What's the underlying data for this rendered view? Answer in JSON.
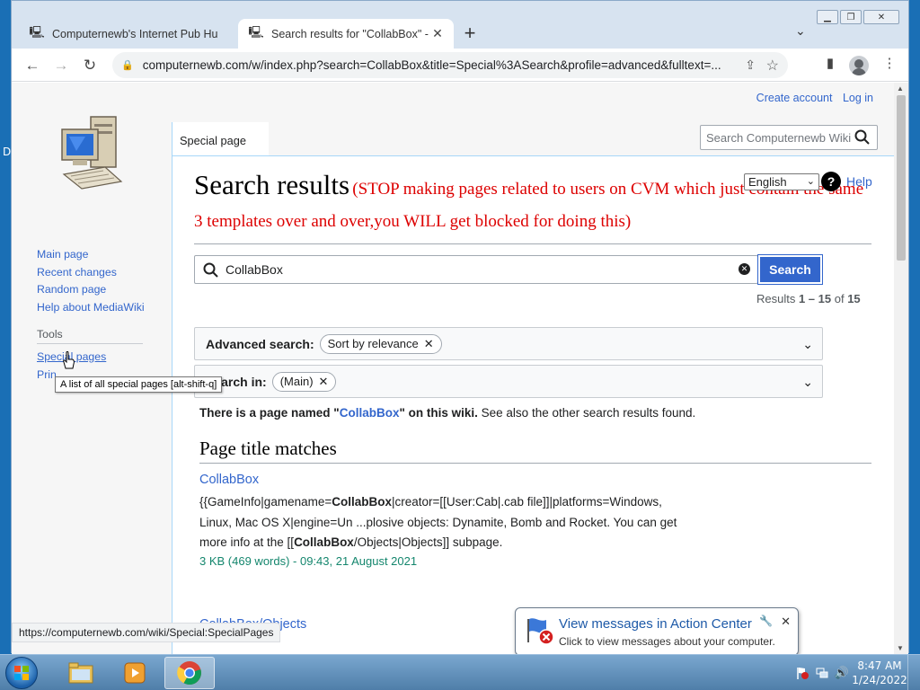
{
  "desktop": {
    "edge_label": "D"
  },
  "browser": {
    "tabs": [
      {
        "title": "Computernewb's Internet Pub Hu",
        "active": false
      },
      {
        "title": "Search results for \"CollabBox\" - C",
        "active": true
      }
    ],
    "new_tab_label": "+",
    "url": "computernewb.com/w/index.php?search=CollabBox&title=Special%3ASearch&profile=advanced&fulltext=...",
    "status_url": "https://computernewb.com/wiki/Special:SpecialPages"
  },
  "wiki": {
    "personal_tools": {
      "create_account": "Create account",
      "log_in": "Log in"
    },
    "tab_special_page": "Special page",
    "search_placeholder": "Search Computernewb Wiki",
    "nav": {
      "main_page": "Main page",
      "recent_changes": "Recent changes",
      "random_page": "Random page",
      "help_about": "Help about MediaWiki",
      "tools_heading": "Tools",
      "special_pages": "Special pages",
      "printable": "Prin"
    },
    "tooltip": "A list of all special pages [alt-shift-q]",
    "heading": "Search results",
    "heading_warning": "(STOP making pages related to users on CVM which just contain the same 3 templates over and over,you WILL get blocked for doing this)",
    "language": "English",
    "help_label": "Help",
    "search_query": "CollabBox",
    "search_button": "Search",
    "results_prefix": "Results ",
    "results_range": "1 – 15",
    "results_of": " of ",
    "results_total": "15",
    "advanced_label": "Advanced search:",
    "advanced_chip": "Sort by relevance",
    "search_in_label": "Search in:",
    "search_in_chip": "(Main)",
    "exists_prefix": "There is a page named \"",
    "exists_title": "CollabBox",
    "exists_suffix": "\" on this wiki.",
    "exists_see_also": " See also the other search results found.",
    "section_title": "Page title matches",
    "result1": {
      "title": "CollabBox",
      "snip_a": "{{GameInfo|gamename=",
      "snip_b": "CollabBox",
      "snip_c": "|creator=[[User:Cab|.cab file]]|platforms=Windows, Linux, Mac OS X|engine=Un ...plosive objects: Dynamite, Bomb and Rocket. You can get more info at the [[",
      "snip_d": "CollabBox",
      "snip_e": "/Objects|Objects]] subpage.",
      "meta": "3 KB (469 words) - 09:43, 21 August 2021"
    },
    "result2_title": "CollabBox/Objects"
  },
  "notification": {
    "title": "View messages in Action Center",
    "subtitle": "Click to view messages about your computer."
  },
  "taskbar": {
    "time": "8:47 AM",
    "date": "1/24/2022"
  }
}
